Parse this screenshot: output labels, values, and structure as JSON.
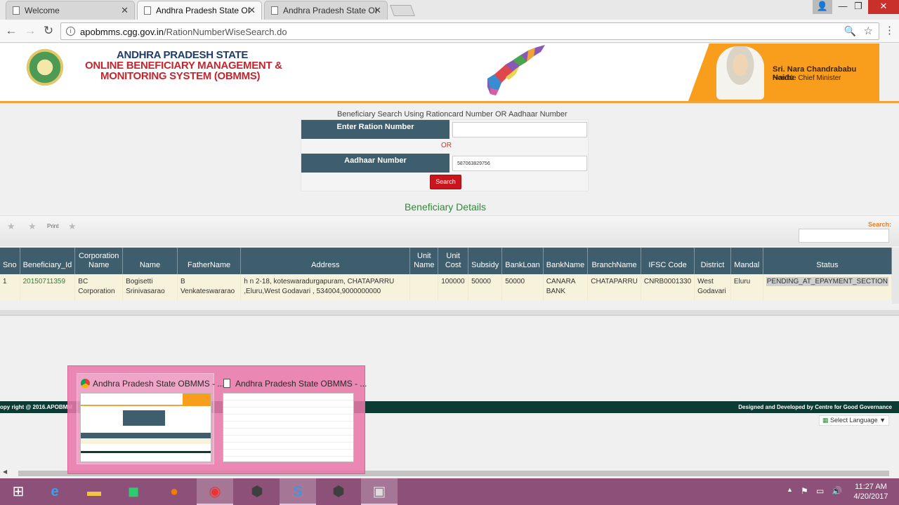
{
  "browser": {
    "tabs": [
      {
        "title": "Welcome",
        "active": false
      },
      {
        "title": "Andhra Pradesh State OI",
        "active": true
      },
      {
        "title": "Andhra Pradesh State OI",
        "active": false
      }
    ],
    "url_domain": "apobmms.cgg.gov.in",
    "url_path": "/RationNumberWiseSearch.do"
  },
  "header": {
    "line1": "ANDHRA PRADESH STATE",
    "line2": "ONLINE BENEFICIARY MANAGEMENT &",
    "line3": "MONITORING SYSTEM (OBMMS)",
    "cm_name": "Sri. Nara Chandrababu Naidu",
    "cm_title": "Hon'ble Chief Minister"
  },
  "search": {
    "caption": "Beneficiary Search Using Rationcard Number OR Aadhaar Number",
    "ration_label": "Enter Ration Number",
    "ration_value": "",
    "or_text": "OR",
    "aadhaar_label": "Aadhaar Number",
    "aadhaar_value": "587063829756",
    "button": "Search"
  },
  "details": {
    "title": "Beneficiary Details",
    "print_label": "Print",
    "search_label": "Search:",
    "columns": [
      "Sno",
      "Beneficiary_Id",
      "Corporation Name",
      "Name",
      "FatherName",
      "Address",
      "Unit Name",
      "Unit Cost",
      "Subsidy",
      "BankLoan",
      "BankName",
      "BranchName",
      "IFSC Code",
      "District",
      "Mandal",
      "Status"
    ],
    "rows": [
      [
        "1",
        "20150711359",
        "BC Corporation",
        "Bogisetti Srinivasarao",
        "B Venkateswararao",
        "h n 2-18, koteswaradurgapuram, CHATAPARRU ,Eluru,West Godavari , 534004,9000000000",
        "",
        "100000",
        "50000",
        "50000",
        "CANARA BANK",
        "CHATAPARRU",
        "CNRB0001330",
        "West Godavari",
        "Eluru",
        "PENDING_AT_EPAYMENT_SECTION"
      ]
    ]
  },
  "footer": {
    "left": "opy right @ 2016.APOBMM",
    "right": "Designed and Developed by Centre for Good Governance",
    "language": "Select Language"
  },
  "taskbar_preview": {
    "items": [
      "Andhra Pradesh State OBMMS - ...",
      "Andhra Pradesh State OBMMS - ..."
    ]
  },
  "clock": {
    "time": "11:27 AM",
    "date": "4/20/2017"
  }
}
